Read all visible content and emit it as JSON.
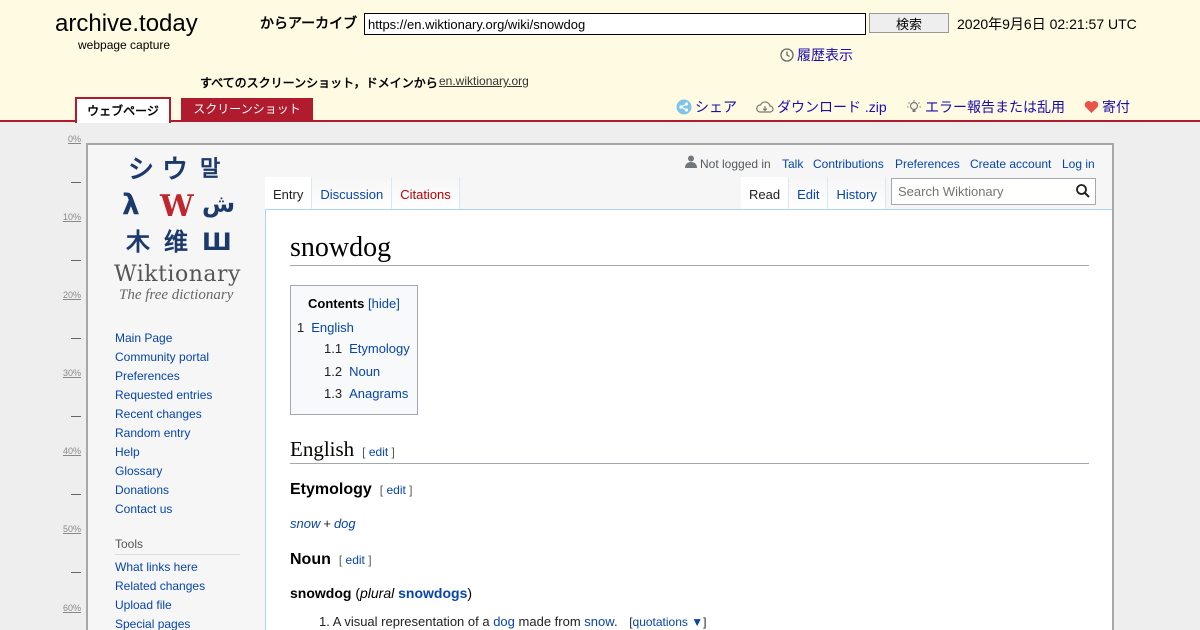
{
  "archive": {
    "brand": "archive.today",
    "brand_sub": "webpage capture",
    "from_label": "からアーカイブ",
    "url": "https://en.wiktionary.org/wiki/snowdog",
    "search_button": "検索",
    "capture_date": "2020年9月6日 02:21:57 UTC",
    "history": "履歴表示",
    "all_screenshots": "すべてのスクリーンショット，ドメインから",
    "domain_link": "en.wiktionary.org",
    "tab_webpage": "ウェブページ",
    "tab_screenshot": "スクリーンショット",
    "share": "シェア",
    "download": "ダウンロード .zip",
    "report": "エラー報告または乱用",
    "donate": "寄付",
    "accent_color": "#b01c2e",
    "header_bg": "#fffae1"
  },
  "ruler": [
    "0%",
    "10%",
    "20%",
    "30%",
    "40%",
    "50%",
    "60%"
  ],
  "wiki": {
    "logo_name": "Wiktionary",
    "logo_tagline": "The free dictionary",
    "nav": [
      "Main Page",
      "Community portal",
      "Preferences",
      "Requested entries",
      "Recent changes",
      "Random entry",
      "Help",
      "Glossary",
      "Donations",
      "Contact us"
    ],
    "tools_heading": "Tools",
    "tools": [
      "What links here",
      "Related changes",
      "Upload file",
      "Special pages"
    ],
    "personal": {
      "not_logged": "Not logged in",
      "talk": "Talk",
      "contributions": "Contributions",
      "preferences": "Preferences",
      "create_account": "Create account",
      "login": "Log in"
    },
    "tabs_left": [
      "Entry",
      "Discussion",
      "Citations"
    ],
    "tabs_right": [
      "Read",
      "Edit",
      "History"
    ],
    "search_placeholder": "Search Wiktionary",
    "title": "snowdog",
    "toc": {
      "heading": "Contents",
      "hide": "[hide]",
      "items": [
        {
          "num": "1",
          "label": "English"
        },
        {
          "num": "1.1",
          "label": "Etymology"
        },
        {
          "num": "1.2",
          "label": "Noun"
        },
        {
          "num": "1.3",
          "label": "Anagrams"
        }
      ]
    },
    "section_english": "English",
    "section_etymology": "Etymology",
    "section_noun": "Noun",
    "edit_label": "edit",
    "etymology": {
      "w1": "snow",
      "plus": "+",
      "w2": "dog"
    },
    "headword": {
      "word": "snowdog",
      "plural_label": "plural",
      "plural": "snowdogs"
    },
    "definition": {
      "num": "1.",
      "t1": "A visual representation of a",
      "link1": "dog",
      "t2": "made from",
      "link2": "snow",
      "t3": ".",
      "quotations": "quotations ▼"
    }
  }
}
